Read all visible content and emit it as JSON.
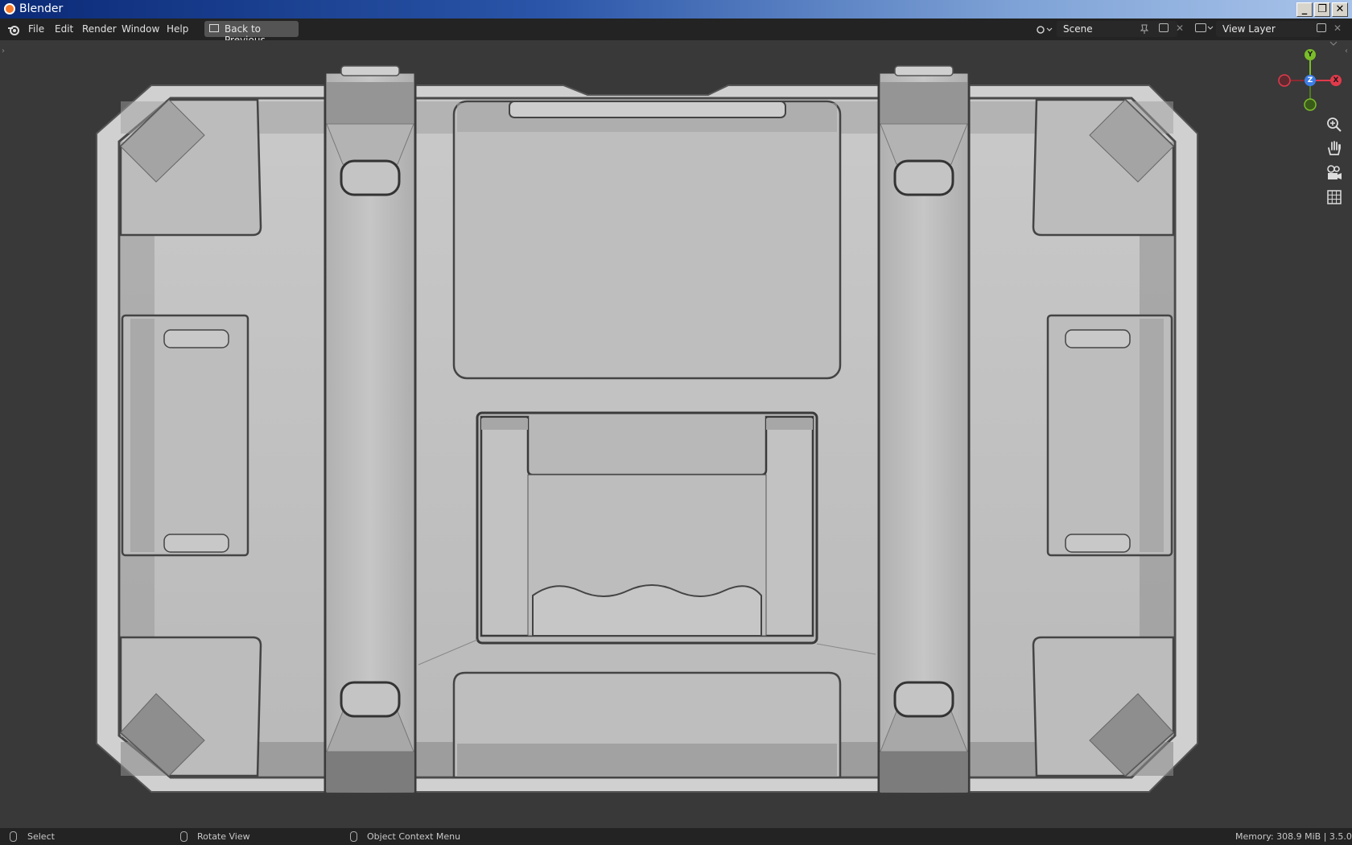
{
  "window": {
    "title": "Blender",
    "minimize": "_",
    "restore": "❐",
    "close": "✕"
  },
  "menu": {
    "file": "File",
    "edit": "Edit",
    "render": "Render",
    "window": "Window",
    "help": "Help",
    "back": "Back to Previous"
  },
  "scene": {
    "label": "Scene",
    "view_layer": "View Layer"
  },
  "gizmo": {
    "y": "Y",
    "x": "X",
    "z": "Z"
  },
  "status": {
    "select": "Select",
    "rotate": "Rotate View",
    "context": "Object Context Menu",
    "memory": "Memory: 308.9 MiB | 3.5.0"
  },
  "colors": {
    "x_axis": "#e23a4b",
    "y_axis": "#7bbd29",
    "z_axis": "#3d7ee6",
    "mesh_face": "#c0c0c0",
    "mesh_edge": "#4a4a4a"
  }
}
